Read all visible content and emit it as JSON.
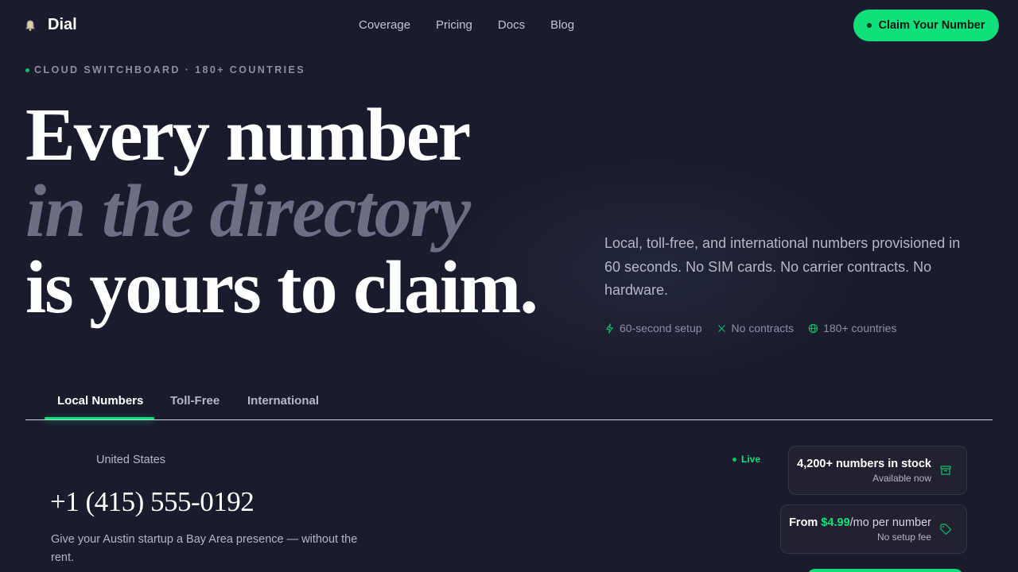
{
  "brand": {
    "name": "Dial",
    "icon": "bell-icon"
  },
  "nav": {
    "items": [
      "Coverage",
      "Pricing",
      "Docs",
      "Blog"
    ]
  },
  "cta": {
    "label": "Claim Your Number"
  },
  "hero": {
    "eyebrow": "CLOUD SWITCHBOARD · 180+ COUNTRIES",
    "line1": "Every number",
    "line2": "in the directory",
    "line3": "is yours to claim.",
    "lede": "Local, toll-free, and international numbers provisioned in 60 seconds. No SIM cards. No carrier contracts. No hardware.",
    "features": [
      {
        "icon": "bolt-icon",
        "label": "60-second setup"
      },
      {
        "icon": "x-icon",
        "label": "No contracts"
      },
      {
        "icon": "globe-icon",
        "label": "180+ countries"
      }
    ]
  },
  "tabs": {
    "items": [
      "Local Numbers",
      "Toll-Free",
      "International"
    ],
    "active": "Local Numbers"
  },
  "listing": {
    "country": "United States",
    "status": "Live",
    "number": "+1 (415) 555-0192",
    "description": "Give your Austin startup a Bay Area presence — without the rent."
  },
  "stats": {
    "stock": {
      "main": "4,200+ numbers in stock",
      "sub": "Available now",
      "icon": "archive-icon"
    },
    "price": {
      "prefix": "From ",
      "amount": "$4.99",
      "suffix": "/mo per number",
      "sub": "No setup fee",
      "icon": "tag-icon"
    }
  },
  "colors": {
    "accent": "#10e07a",
    "background": "#1b1b2e",
    "muted": "#6d6d86"
  }
}
